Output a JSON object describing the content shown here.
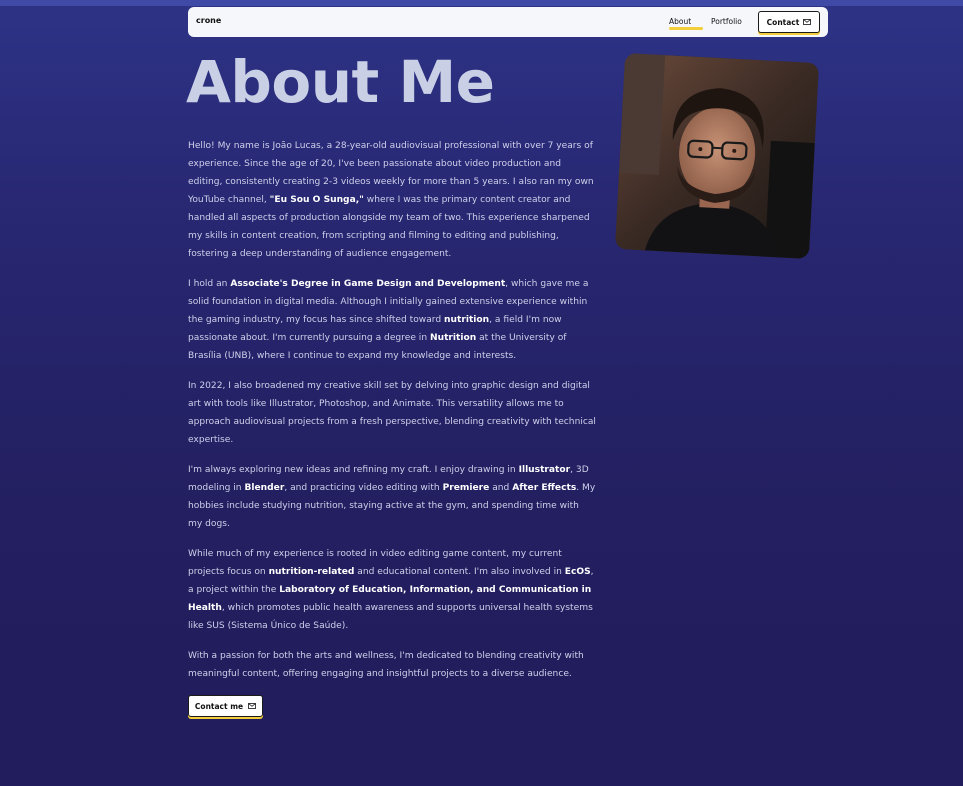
{
  "nav": {
    "brand": "crone",
    "about": "About",
    "portfolio": "Portfolio",
    "contact": "Contact"
  },
  "title": "About Me",
  "paragraphs": [
    {
      "segments": [
        {
          "t": "Hello! My name is João Lucas, a 28-year-old audiovisual professional with over 7 years of experience. Since the age of 20, I've been passionate about video production and editing, consistently creating 2-3 videos weekly for more than 5 years. I also ran my own YouTube channel, "
        },
        {
          "t": "\"Eu Sou O Sunga,\"",
          "b": true
        },
        {
          "t": " where I was the primary content creator and handled all aspects of production alongside my team of two. This experience sharpened my skills in content creation, from scripting and filming to editing and publishing, fostering a deep understanding of audience engagement."
        }
      ]
    },
    {
      "segments": [
        {
          "t": "I hold an "
        },
        {
          "t": "Associate's Degree in Game Design and Development",
          "b": true
        },
        {
          "t": ", which gave me a solid foundation in digital media. Although I initially gained extensive experience within the gaming industry, my focus has since shifted toward "
        },
        {
          "t": "nutrition",
          "b": true
        },
        {
          "t": ", a field I'm now passionate about. I'm currently pursuing a degree in "
        },
        {
          "t": "Nutrition",
          "b": true
        },
        {
          "t": " at the University of Brasília (UNB), where I continue to expand my knowledge and interests."
        }
      ]
    },
    {
      "segments": [
        {
          "t": "In 2022, I also broadened my creative skill set by delving into graphic design and digital art with tools like Illustrator, Photoshop, and Animate. This versatility allows me to approach audiovisual projects from a fresh perspective, blending creativity with technical expertise."
        }
      ]
    },
    {
      "segments": [
        {
          "t": "I'm always exploring new ideas and refining my craft. I enjoy drawing in "
        },
        {
          "t": "Illustrator",
          "b": true
        },
        {
          "t": ", 3D modeling in "
        },
        {
          "t": "Blender",
          "b": true
        },
        {
          "t": ", and practicing video editing with "
        },
        {
          "t": "Premiere",
          "b": true
        },
        {
          "t": " and "
        },
        {
          "t": "After Effects",
          "b": true
        },
        {
          "t": ". My hobbies include studying nutrition, staying active at the gym, and spending time with my dogs."
        }
      ]
    },
    {
      "segments": [
        {
          "t": "While much of my experience is rooted in video editing game content, my current projects focus on "
        },
        {
          "t": "nutrition-related",
          "b": true
        },
        {
          "t": " and educational content. I'm also involved in "
        },
        {
          "t": "EcOS",
          "b": true
        },
        {
          "t": ", a project within the "
        },
        {
          "t": "Laboratory of Education, Information, and Communication in Health",
          "b": true
        },
        {
          "t": ", which promotes public health awareness and supports universal health systems like SUS (Sistema Único de Saúde)."
        }
      ]
    },
    {
      "segments": [
        {
          "t": "With a passion for both the arts and wellness, I'm dedicated to blending creativity with meaningful content, offering engaging and insightful projects to a diverse audience."
        }
      ]
    }
  ],
  "cta": {
    "label": "Contact me",
    "icon": "mail-icon"
  },
  "photo": {
    "icon": "profile-photo"
  },
  "colors": {
    "accent": "#f4ce3a",
    "background": "#26256b",
    "title": "#c9d0e6"
  }
}
